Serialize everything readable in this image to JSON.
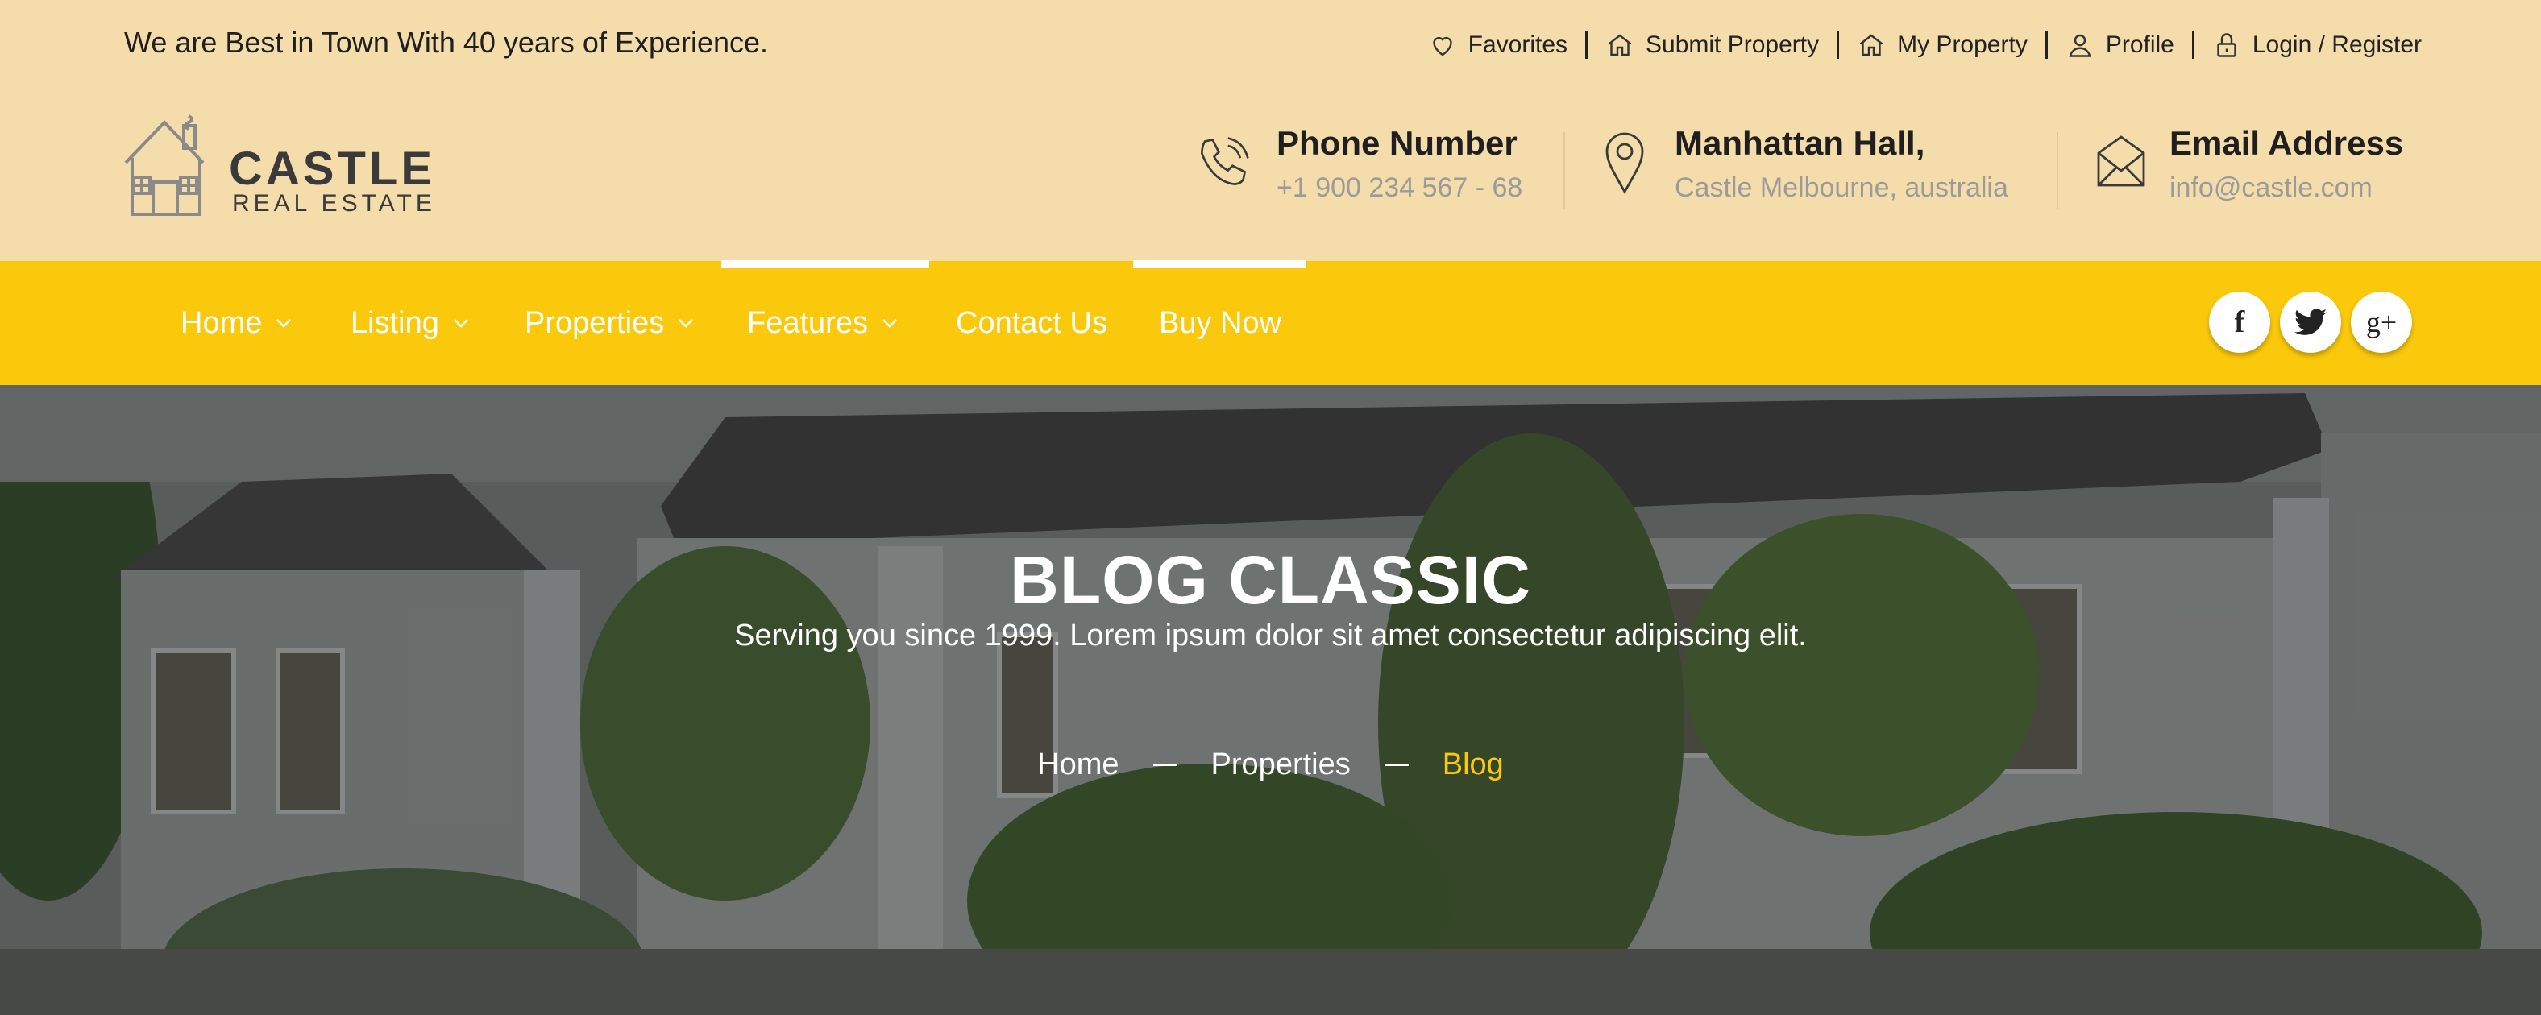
{
  "header": {
    "tagline": "We are Best in Town With 40 years of Experience.",
    "top_links": [
      {
        "label": "Favorites",
        "icon": "heart-icon"
      },
      {
        "label": "Submit Property",
        "icon": "house-icon"
      },
      {
        "label": "My Property",
        "icon": "house-icon"
      },
      {
        "label": "Profile",
        "icon": "user-icon"
      },
      {
        "label": "Login / Register",
        "icon": "lock-icon"
      }
    ],
    "logo": {
      "name": "CASTLE",
      "tagline": "REAL ESTATE"
    },
    "contacts": [
      {
        "title": "Phone Number",
        "detail": "+1 900 234 567 - 68",
        "icon": "phone-icon"
      },
      {
        "title": "Manhattan Hall,",
        "detail": "Castle Melbourne, australia",
        "icon": "map-pin-icon"
      },
      {
        "title": "Email Address",
        "detail": "info@castle.com",
        "icon": "envelope-icon"
      }
    ]
  },
  "nav": {
    "items": [
      {
        "label": "Home",
        "has_dropdown": true
      },
      {
        "label": "Listing",
        "has_dropdown": true
      },
      {
        "label": "Properties",
        "has_dropdown": true
      },
      {
        "label": "Features",
        "has_dropdown": true
      },
      {
        "label": "Contact Us",
        "has_dropdown": false
      },
      {
        "label": "Buy Now",
        "has_dropdown": false
      }
    ],
    "social": [
      {
        "glyph": "f",
        "icon": "facebook-icon"
      },
      {
        "glyph": "t",
        "icon": "twitter-icon"
      },
      {
        "glyph": "g+",
        "icon": "google-plus-icon"
      }
    ]
  },
  "hero": {
    "title": "BLOG CLASSIC",
    "subtitle": "Serving you since 1999. Lorem ipsum dolor sit amet consectetur adipiscing elit.",
    "breadcrumb": [
      "Home",
      "Properties",
      "Blog"
    ]
  },
  "colors": {
    "header_bg": "#f4dcab",
    "nav_bg": "#fbc90b",
    "accent": "#fbc90b",
    "muted_text": "#9b9b9b"
  }
}
